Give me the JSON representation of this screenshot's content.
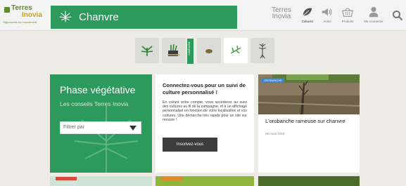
{
  "header": {
    "logo_line1": "Terres",
    "logo_line2": "Inovia",
    "logo_tagline": "l'agronomie en mouvement",
    "crop_title": "Chanvre",
    "brand_text": "Terres",
    "brand_sub": "Inovia",
    "nav": [
      {
        "label": "Cultures",
        "icon": "leaf-icon"
      },
      {
        "label": "Actus",
        "icon": "megaphone-icon"
      },
      {
        "label": "Produits",
        "icon": "basket-icon"
      },
      {
        "label": "Me connecter",
        "icon": "user-icon"
      }
    ],
    "search_icon": "search-icon"
  },
  "phases": {
    "active_tab_label": "CAMPAGNE",
    "buttons": [
      {
        "icon": "plant-icon"
      },
      {
        "icon": "harvest-icon"
      },
      {
        "icon": "seed-icon"
      },
      {
        "icon": "leaf-spray-icon"
      },
      {
        "icon": "root-plant-icon"
      }
    ]
  },
  "phase_card": {
    "title": "Phase végétative",
    "subtitle": "Les conseils Terres Inovia",
    "filter_placeholder": "Filtrer par"
  },
  "login_card": {
    "title": "Connectez-vous pour un suivi de culture personnalisé !",
    "text": "En créant votre compte, vous accéderez au suivi des cultures au fil de la campagne, et à un affichage personnalisé en fonction de votre localisation et vos cultures. Une démarche très rapide pour un site sur mesure !",
    "button_label": "Inscrivez-vous"
  },
  "article": {
    "tag": "OROBANCHE",
    "title": "L'orobanche rameuse sur chanvre",
    "date": "09 mars 2019"
  },
  "colors": {
    "brand_green": "#2c9a5c",
    "background": "#ecebe6",
    "tag_blue": "#3d84c5"
  }
}
